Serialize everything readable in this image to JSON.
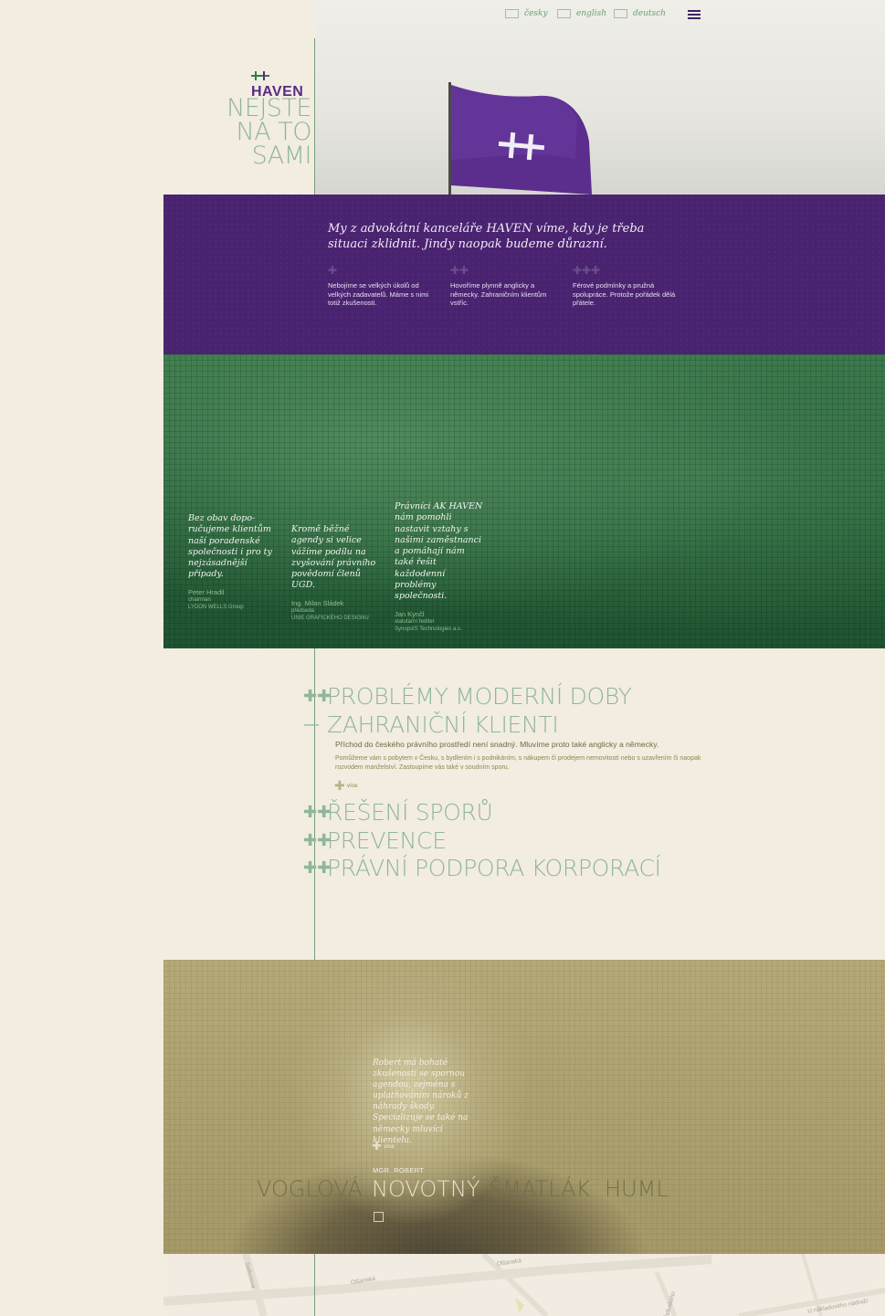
{
  "header": {
    "languages": [
      {
        "label": "česky",
        "icon": "flag-cz-icon"
      },
      {
        "label": "english",
        "icon": "flag-en-icon"
      },
      {
        "label": "deutsch",
        "icon": "flag-de-icon"
      }
    ],
    "menu_icon": "hamburger-menu-icon"
  },
  "brand": {
    "logo_text": "HAVEN",
    "slogan_lines": [
      "NEJSTE",
      "NA TO",
      "SAMI"
    ],
    "colors": {
      "purple": "#4a2370",
      "green": "#2e6a3e",
      "mint": "#8fb69a",
      "khaki": "#a59968"
    }
  },
  "intro": {
    "headline": "My z advokátní kanceláře HAVEN víme, kdy je třeba situaci zklidnit. Jindy naopak budeme důrazní.",
    "features": [
      {
        "text": "Nebojíme se velkých úkolů od velkých zadavatelů. Máme s nimi totiž zkušenosti.",
        "icon": "single-cross-icon"
      },
      {
        "text": "Hovoříme plynně anglicky a německy. Zahraničním klientům vstříc.",
        "icon": "double-cross-icon"
      },
      {
        "text": "Férové podmínky a pružná spolupráce. Protože pořádek dělá přátele.",
        "icon": "triple-cross-icon"
      }
    ]
  },
  "testimonials": [
    {
      "quote": "Bez obav dopo-ručujeme klientům naší poradenské společnosti i pro ty nejzásadnější případy.",
      "name": "Peter Hradil",
      "role": "chairman",
      "org": "LYDON WELLS Group"
    },
    {
      "quote": "Kromě běžné agendy si velice vážíme podílu na zvyšování právního povědomí členů UGD.",
      "name": "Ing. Milan Sládek",
      "role": "předseda",
      "org": "UNIE GRAFICKÉHO DESIGNU"
    },
    {
      "quote": "Právníci AK HAVEN nám pomohli nastavit vztahy s našimi zaměstnanci a pomáhají nám také řešit každodenní problémy společnosti.",
      "name": "Jan Kynčl",
      "role": "statutární ředitel",
      "org": "SynopsIS Technologies a.s."
    }
  ],
  "services": {
    "items": [
      {
        "label": "PROBLÉMY MODERNÍ DOBY",
        "icon": "double-cross-icon",
        "expanded": false
      },
      {
        "label": "ZAHRANIČNÍ KLIENTI",
        "icon": "minus-icon",
        "expanded": true
      },
      {
        "label": "ŘEŠENÍ SPORŮ",
        "icon": "double-cross-icon",
        "expanded": false
      },
      {
        "label": "PREVENCE",
        "icon": "double-cross-icon",
        "expanded": false
      },
      {
        "label": "PRÁVNÍ PODPORA KORPORACÍ",
        "icon": "double-cross-icon",
        "expanded": false
      }
    ],
    "expanded_lead": "Příchod do českého právního prostředí není snadný. Mluvíme proto také anglicky a německy.",
    "expanded_body": "Pomůžeme vám s pobytem v Česku, s bydlením i s podnikáním, s nákupem či prodejem nemovitostí nebo s uzavřením či naopak rozvodem manželství. Zastoupíme vás také v soudním sporu.",
    "more_label": "více"
  },
  "lawyers": {
    "bio": "Robert má bohaté zkušenosti se spornou agendou, zejména s uplatňováním nároků z náhrady škody. Specializuje se také na německy mluvící klientelu.",
    "more_label": "více",
    "active_name": "MGR. ROBERT",
    "surnames": [
      "VOGLOVÁ",
      "NOVOTNÝ",
      "ŠMATLÁK",
      "HUML"
    ],
    "active_index": 1
  },
  "map": {
    "streets": [
      "Olšanská",
      "Olšanská",
      "Seifertova",
      "J. Želivského",
      "U nákladového nádraží"
    ]
  }
}
